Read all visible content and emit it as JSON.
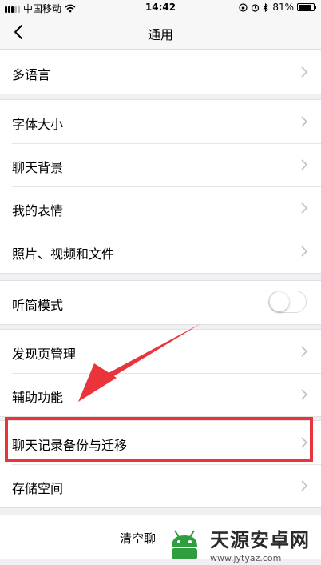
{
  "status_bar": {
    "carrier": "中国移动",
    "time": "14:42",
    "battery_percent": "81%",
    "battery_level": 0.81
  },
  "nav": {
    "title": "通用"
  },
  "groups": [
    {
      "rows": [
        {
          "label": "多语言"
        }
      ]
    },
    {
      "rows": [
        {
          "label": "字体大小"
        },
        {
          "label": "聊天背景"
        },
        {
          "label": "我的表情"
        },
        {
          "label": "照片、视频和文件"
        }
      ]
    },
    {
      "rows": [
        {
          "label": "听筒模式",
          "toggle_on": false
        }
      ]
    },
    {
      "rows": [
        {
          "label": "发现页管理"
        },
        {
          "label": "辅助功能"
        }
      ]
    },
    {
      "rows": [
        {
          "label": "聊天记录备份与迁移"
        },
        {
          "label": "存储空间"
        }
      ]
    }
  ],
  "clear_button": {
    "label": "清空聊"
  },
  "watermark": {
    "title": "天源安卓网",
    "url": "www.jytyaz.com"
  },
  "colors": {
    "highlight": "#e8343a",
    "watermark_green": "#2e9e3e"
  }
}
